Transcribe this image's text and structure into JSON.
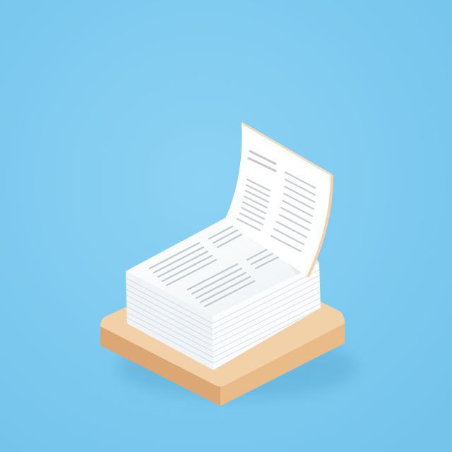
{
  "scene": {
    "subject": "stack-of-papers-icon",
    "palette": {
      "background": "#7fcbf0",
      "background_light": "#8dd3f4",
      "wood_top": "#f2cfa6",
      "wood_side": "#e3b17f",
      "paper": "#ffffff",
      "paper_shade": "#e9eef2",
      "text_lines": "#c7ccd2"
    }
  }
}
